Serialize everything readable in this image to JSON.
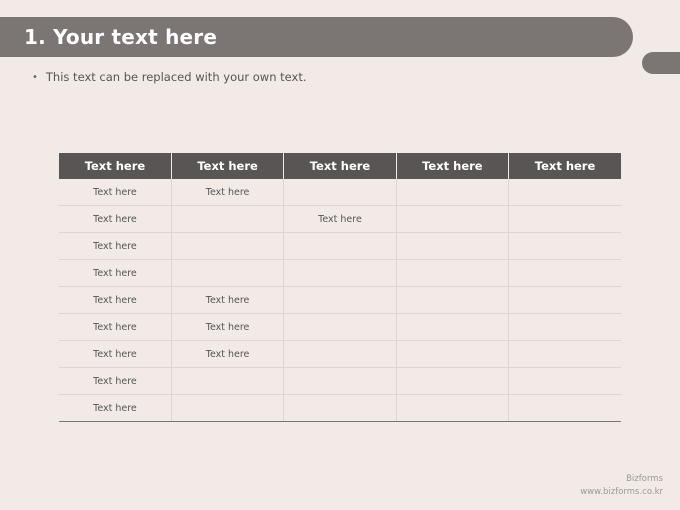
{
  "slide": {
    "title": "1. Your text here",
    "bullet": "This text can be replaced with your own text."
  },
  "table": {
    "headers": [
      "Text here",
      "Text here",
      "Text here",
      "Text here",
      "Text here"
    ],
    "rows": [
      [
        "Text here",
        "Text here",
        "",
        "",
        ""
      ],
      [
        "Text here",
        "",
        "Text here",
        "",
        ""
      ],
      [
        "Text here",
        "",
        "",
        "",
        ""
      ],
      [
        "Text here",
        "",
        "",
        "",
        ""
      ],
      [
        "Text here",
        "Text here",
        "",
        "",
        ""
      ],
      [
        "Text here",
        "Text here",
        "",
        "",
        ""
      ],
      [
        "Text here",
        "Text here",
        "",
        "",
        ""
      ],
      [
        "Text here",
        "",
        "",
        "",
        ""
      ],
      [
        "Text here",
        "",
        "",
        "",
        ""
      ]
    ]
  },
  "footer": {
    "brand": "Bizforms",
    "url": "www.bizforms.co.kr"
  },
  "colors": {
    "background": "#f2eae7",
    "title_bar": "#7b7574",
    "table_header": "#5a5555"
  }
}
